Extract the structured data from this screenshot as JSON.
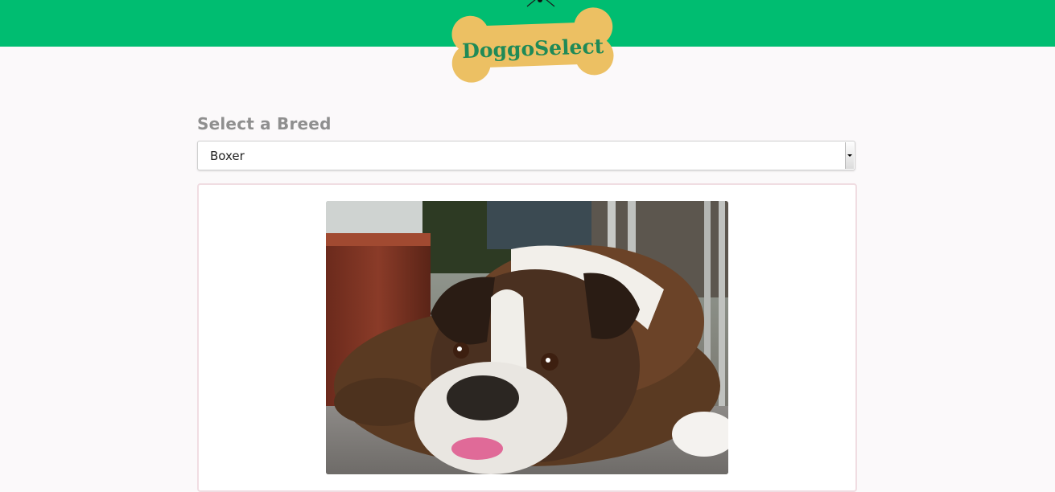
{
  "header": {
    "brand": "DoggoSelect",
    "bar_color": "#00bd71",
    "logo_color": "#ecc063",
    "logo_text_color": "#1f8a57",
    "logo_icon": "dog-bone-icon"
  },
  "selector": {
    "label": "Select a Breed",
    "selected": "Boxer",
    "arrow_icon": "chevron-down-icon"
  },
  "result": {
    "image_subject": "boxer-dog-photo",
    "border_color": "#f0dde2"
  }
}
